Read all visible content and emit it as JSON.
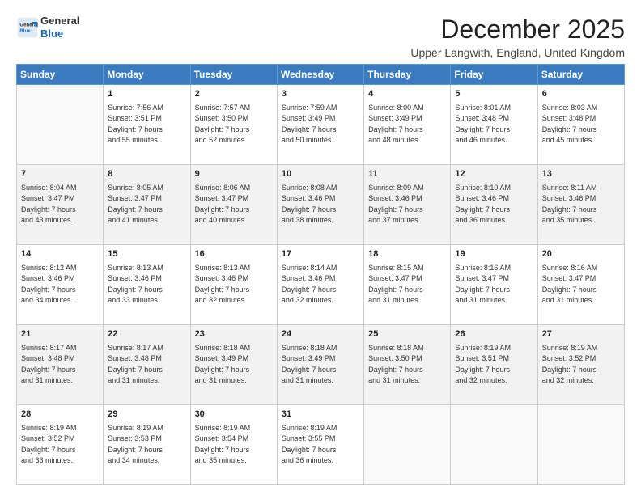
{
  "logo": {
    "line1": "General",
    "line2": "Blue"
  },
  "header": {
    "month": "December 2025",
    "location": "Upper Langwith, England, United Kingdom"
  },
  "days_of_week": [
    "Sunday",
    "Monday",
    "Tuesday",
    "Wednesday",
    "Thursday",
    "Friday",
    "Saturday"
  ],
  "weeks": [
    [
      {
        "day": "",
        "sunrise": "",
        "sunset": "",
        "daylight": ""
      },
      {
        "day": "1",
        "sunrise": "Sunrise: 7:56 AM",
        "sunset": "Sunset: 3:51 PM",
        "daylight": "Daylight: 7 hours and 55 minutes."
      },
      {
        "day": "2",
        "sunrise": "Sunrise: 7:57 AM",
        "sunset": "Sunset: 3:50 PM",
        "daylight": "Daylight: 7 hours and 52 minutes."
      },
      {
        "day": "3",
        "sunrise": "Sunrise: 7:59 AM",
        "sunset": "Sunset: 3:49 PM",
        "daylight": "Daylight: 7 hours and 50 minutes."
      },
      {
        "day": "4",
        "sunrise": "Sunrise: 8:00 AM",
        "sunset": "Sunset: 3:49 PM",
        "daylight": "Daylight: 7 hours and 48 minutes."
      },
      {
        "day": "5",
        "sunrise": "Sunrise: 8:01 AM",
        "sunset": "Sunset: 3:48 PM",
        "daylight": "Daylight: 7 hours and 46 minutes."
      },
      {
        "day": "6",
        "sunrise": "Sunrise: 8:03 AM",
        "sunset": "Sunset: 3:48 PM",
        "daylight": "Daylight: 7 hours and 45 minutes."
      }
    ],
    [
      {
        "day": "7",
        "sunrise": "Sunrise: 8:04 AM",
        "sunset": "Sunset: 3:47 PM",
        "daylight": "Daylight: 7 hours and 43 minutes."
      },
      {
        "day": "8",
        "sunrise": "Sunrise: 8:05 AM",
        "sunset": "Sunset: 3:47 PM",
        "daylight": "Daylight: 7 hours and 41 minutes."
      },
      {
        "day": "9",
        "sunrise": "Sunrise: 8:06 AM",
        "sunset": "Sunset: 3:47 PM",
        "daylight": "Daylight: 7 hours and 40 minutes."
      },
      {
        "day": "10",
        "sunrise": "Sunrise: 8:08 AM",
        "sunset": "Sunset: 3:46 PM",
        "daylight": "Daylight: 7 hours and 38 minutes."
      },
      {
        "day": "11",
        "sunrise": "Sunrise: 8:09 AM",
        "sunset": "Sunset: 3:46 PM",
        "daylight": "Daylight: 7 hours and 37 minutes."
      },
      {
        "day": "12",
        "sunrise": "Sunrise: 8:10 AM",
        "sunset": "Sunset: 3:46 PM",
        "daylight": "Daylight: 7 hours and 36 minutes."
      },
      {
        "day": "13",
        "sunrise": "Sunrise: 8:11 AM",
        "sunset": "Sunset: 3:46 PM",
        "daylight": "Daylight: 7 hours and 35 minutes."
      }
    ],
    [
      {
        "day": "14",
        "sunrise": "Sunrise: 8:12 AM",
        "sunset": "Sunset: 3:46 PM",
        "daylight": "Daylight: 7 hours and 34 minutes."
      },
      {
        "day": "15",
        "sunrise": "Sunrise: 8:13 AM",
        "sunset": "Sunset: 3:46 PM",
        "daylight": "Daylight: 7 hours and 33 minutes."
      },
      {
        "day": "16",
        "sunrise": "Sunrise: 8:13 AM",
        "sunset": "Sunset: 3:46 PM",
        "daylight": "Daylight: 7 hours and 32 minutes."
      },
      {
        "day": "17",
        "sunrise": "Sunrise: 8:14 AM",
        "sunset": "Sunset: 3:46 PM",
        "daylight": "Daylight: 7 hours and 32 minutes."
      },
      {
        "day": "18",
        "sunrise": "Sunrise: 8:15 AM",
        "sunset": "Sunset: 3:47 PM",
        "daylight": "Daylight: 7 hours and 31 minutes."
      },
      {
        "day": "19",
        "sunrise": "Sunrise: 8:16 AM",
        "sunset": "Sunset: 3:47 PM",
        "daylight": "Daylight: 7 hours and 31 minutes."
      },
      {
        "day": "20",
        "sunrise": "Sunrise: 8:16 AM",
        "sunset": "Sunset: 3:47 PM",
        "daylight": "Daylight: 7 hours and 31 minutes."
      }
    ],
    [
      {
        "day": "21",
        "sunrise": "Sunrise: 8:17 AM",
        "sunset": "Sunset: 3:48 PM",
        "daylight": "Daylight: 7 hours and 31 minutes."
      },
      {
        "day": "22",
        "sunrise": "Sunrise: 8:17 AM",
        "sunset": "Sunset: 3:48 PM",
        "daylight": "Daylight: 7 hours and 31 minutes."
      },
      {
        "day": "23",
        "sunrise": "Sunrise: 8:18 AM",
        "sunset": "Sunset: 3:49 PM",
        "daylight": "Daylight: 7 hours and 31 minutes."
      },
      {
        "day": "24",
        "sunrise": "Sunrise: 8:18 AM",
        "sunset": "Sunset: 3:49 PM",
        "daylight": "Daylight: 7 hours and 31 minutes."
      },
      {
        "day": "25",
        "sunrise": "Sunrise: 8:18 AM",
        "sunset": "Sunset: 3:50 PM",
        "daylight": "Daylight: 7 hours and 31 minutes."
      },
      {
        "day": "26",
        "sunrise": "Sunrise: 8:19 AM",
        "sunset": "Sunset: 3:51 PM",
        "daylight": "Daylight: 7 hours and 32 minutes."
      },
      {
        "day": "27",
        "sunrise": "Sunrise: 8:19 AM",
        "sunset": "Sunset: 3:52 PM",
        "daylight": "Daylight: 7 hours and 32 minutes."
      }
    ],
    [
      {
        "day": "28",
        "sunrise": "Sunrise: 8:19 AM",
        "sunset": "Sunset: 3:52 PM",
        "daylight": "Daylight: 7 hours and 33 minutes."
      },
      {
        "day": "29",
        "sunrise": "Sunrise: 8:19 AM",
        "sunset": "Sunset: 3:53 PM",
        "daylight": "Daylight: 7 hours and 34 minutes."
      },
      {
        "day": "30",
        "sunrise": "Sunrise: 8:19 AM",
        "sunset": "Sunset: 3:54 PM",
        "daylight": "Daylight: 7 hours and 35 minutes."
      },
      {
        "day": "31",
        "sunrise": "Sunrise: 8:19 AM",
        "sunset": "Sunset: 3:55 PM",
        "daylight": "Daylight: 7 hours and 36 minutes."
      },
      {
        "day": "",
        "sunrise": "",
        "sunset": "",
        "daylight": ""
      },
      {
        "day": "",
        "sunrise": "",
        "sunset": "",
        "daylight": ""
      },
      {
        "day": "",
        "sunrise": "",
        "sunset": "",
        "daylight": ""
      }
    ]
  ]
}
